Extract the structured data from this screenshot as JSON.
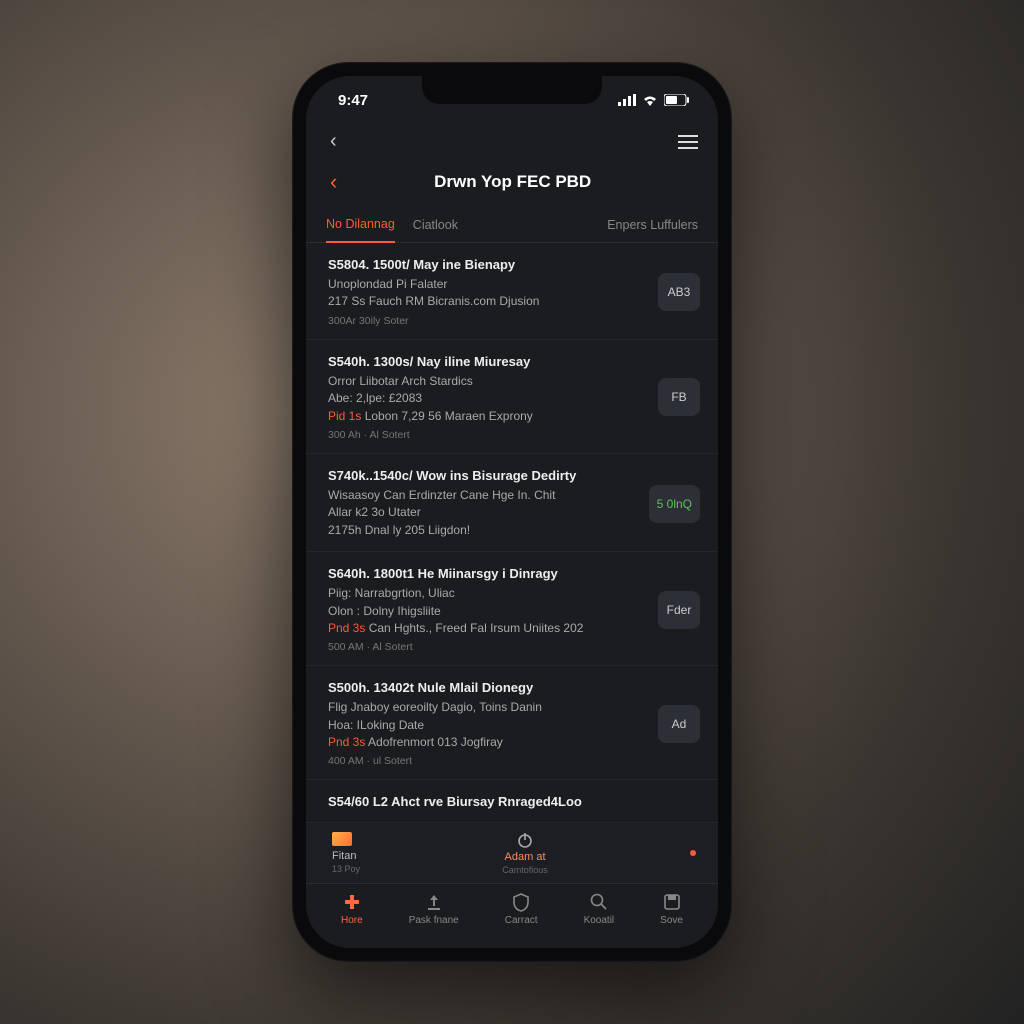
{
  "status": {
    "time": "9:47"
  },
  "header": {
    "title": "Drwn Yop FEC PBD"
  },
  "tabs": {
    "left1": "No Dilannag",
    "left2": "Ciatlook",
    "right": "Enpers Luffulers"
  },
  "items": [
    {
      "h": "S5804. 1500t/ May ine Bienapy",
      "l1": "Unoplondad Pi Falater",
      "l2": "217 Ss Fauch RM Bicranis.com Djusion",
      "meta": "300Ar  30ily Soter",
      "badge": "AB3"
    },
    {
      "h": "S540h. 1300s/ Nay iline Miuresay",
      "l1": "Orror Liibotar Arch Stardics",
      "l2a": "Abe: 2,lpe: £2083",
      "l2b_prefix": "Pid 1s",
      "l2b": " Lobon 7,29 56 Maraen Exprony",
      "meta": "300 Ah · Al Sotert",
      "badge": "FB"
    },
    {
      "h": "S740k..1540c/ Wow ins Bisurage Dedirty",
      "l1": "Wisaasoy Can Erdinzter Cane Hge In. Chit",
      "l2": "Allar k2 3o Utater",
      "l3": "2175h Dnal ly 205 Liigdon!",
      "meta": "",
      "badge": "5 0lnQ",
      "badgeGreen": true
    },
    {
      "h": "S640h. 1800t1 He Miinarsgy i Dinragy",
      "l1": "Piig: Narrabgrtion, Uliac",
      "l2": "Olon : Dolny Ihigsliite",
      "l3_prefix": "Pnd 3s",
      "l3": " Can Hghts., Freed Fal Irsum Uniites 202",
      "meta": "500 AM · Al Sotert",
      "badge": "Fder"
    },
    {
      "h": "S500h. 13402t Nule Mlail Dionegy",
      "l1": "Flig Jnaboy eoreoilty Dagio, Toins Danin",
      "l2": "Hoa: ILoking Date",
      "l3_prefix": "Pnd 3s",
      "l3": " Adofrenmort 013 Jogfiray",
      "meta": "400 AM · ul Sotert",
      "badge": "Ad"
    },
    {
      "h": "S54/60 L2 Ahct rve Biursay Rnraged4Loo"
    }
  ],
  "quick": {
    "left_label": "Fitan",
    "left_sub": "13 Poy",
    "center_label": "Adam at",
    "center_sub": "Camtofious"
  },
  "tabbar": {
    "t1": "Hore",
    "t2": "Pask fnane",
    "t3": "Carract",
    "t4": "Kooatil",
    "t5": "Sove"
  }
}
